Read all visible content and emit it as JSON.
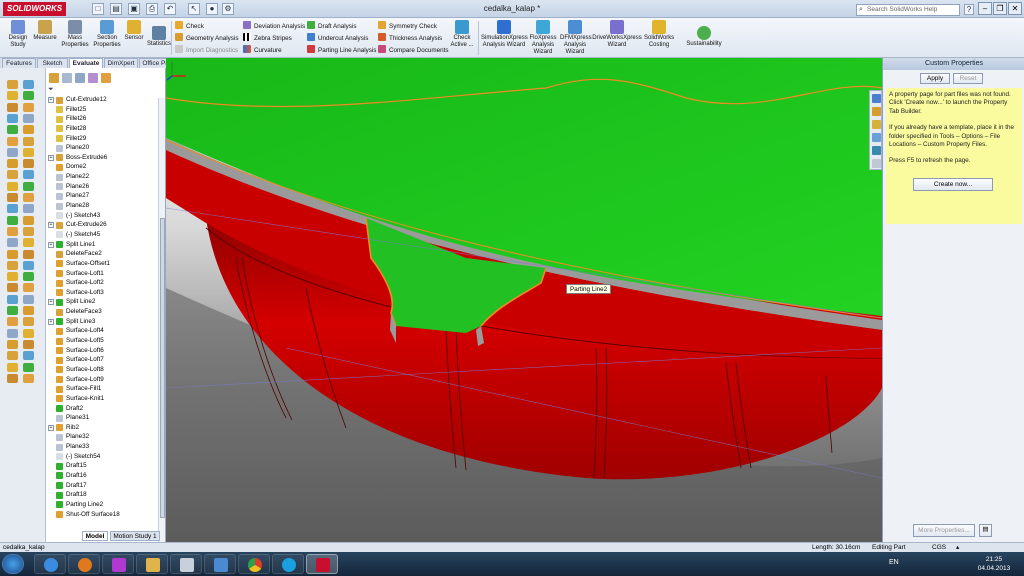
{
  "app": {
    "logo": "SOLIDWORKS",
    "document_title": "cedalka_kalap *",
    "help_search_placeholder": "Search SolidWorks Help"
  },
  "toolbar": {
    "design_study": "Design Study",
    "measure": "Measure",
    "mass_properties": "Mass Properties",
    "section_properties": "Section Properties",
    "sensor": "Sensor",
    "statistics": "Statistics",
    "check": "Check",
    "geometry_analysis": "Geometry Analysis",
    "import_diagnostics": "Import Diagnostics",
    "deviation_analysis": "Deviation Analysis",
    "zebra_stripes": "Zebra Stripes",
    "curvature": "Curvature",
    "draft_analysis": "Draft Analysis",
    "undercut_analysis": "Undercut Analysis",
    "parting_line_analysis": "Parting Line Analysis",
    "symmetry_check": "Symmetry Check",
    "thickness_analysis": "Thickness Analysis",
    "compare_documents": "Compare Documents",
    "check_active": "Check Active ...",
    "simulationxpress": "SimulationXpress Analysis Wizard",
    "floxpress": "FloXpress Analysis Wizard",
    "dfmxpress": "DFMXpress Analysis Wizard",
    "driveworksxpress": "DriveWorksXpress Wizard",
    "costing": "SolidWorks Costing",
    "sustainability": "Sustainability"
  },
  "tabs": [
    "Features",
    "Sketch",
    "Evaluate",
    "DimXpert",
    "Office Products"
  ],
  "active_tab": "Evaluate",
  "tree": {
    "filter_icon": "filter-icon",
    "items": [
      {
        "label": "Cut-Extrude12",
        "expandable": true
      },
      {
        "label": "Fillet25",
        "expandable": false
      },
      {
        "label": "Fillet26",
        "expandable": false
      },
      {
        "label": "Fillet28",
        "expandable": false
      },
      {
        "label": "Fillet29",
        "expandable": false
      },
      {
        "label": "Plane20",
        "expandable": false
      },
      {
        "label": "Boss-Extrude6",
        "expandable": true
      },
      {
        "label": "Dome2",
        "expandable": false
      },
      {
        "label": "Plane22",
        "expandable": false
      },
      {
        "label": "Plane26",
        "expandable": false
      },
      {
        "label": "Plane27",
        "expandable": false
      },
      {
        "label": "Plane28",
        "expandable": false
      },
      {
        "label": "(-) Sketch43",
        "expandable": false
      },
      {
        "label": "Cut-Extrude26",
        "expandable": true
      },
      {
        "label": "(-) Sketch45",
        "expandable": false
      },
      {
        "label": "Split Line1",
        "expandable": true
      },
      {
        "label": "DeleteFace2",
        "expandable": false
      },
      {
        "label": "Surface-Offset1",
        "expandable": false
      },
      {
        "label": "Surface-Loft1",
        "expandable": false
      },
      {
        "label": "Surface-Loft2",
        "expandable": false
      },
      {
        "label": "Surface-Loft3",
        "expandable": false
      },
      {
        "label": "Split Line2",
        "expandable": true
      },
      {
        "label": "DeleteFace3",
        "expandable": false
      },
      {
        "label": "Split Line3",
        "expandable": true
      },
      {
        "label": "Surface-Loft4",
        "expandable": false
      },
      {
        "label": "Surface-Loft5",
        "expandable": false
      },
      {
        "label": "Surface-Loft6",
        "expandable": false
      },
      {
        "label": "Surface-Loft7",
        "expandable": false
      },
      {
        "label": "Surface-Loft8",
        "expandable": false
      },
      {
        "label": "Surface-Loft9",
        "expandable": false
      },
      {
        "label": "Surface-Fill1",
        "expandable": false
      },
      {
        "label": "Surface-Knit1",
        "expandable": false
      },
      {
        "label": "Draft2",
        "expandable": false
      },
      {
        "label": "Plane31",
        "expandable": false
      },
      {
        "label": "Rib2",
        "expandable": true
      },
      {
        "label": "Plane32",
        "expandable": false
      },
      {
        "label": "Plane33",
        "expandable": false
      },
      {
        "label": "(-) Sketch54",
        "expandable": false
      },
      {
        "label": "Draft15",
        "expandable": false
      },
      {
        "label": "Draft16",
        "expandable": false
      },
      {
        "label": "Draft17",
        "expandable": false
      },
      {
        "label": "Draft18",
        "expandable": false
      },
      {
        "label": "Parting Line2",
        "expandable": false
      },
      {
        "label": "Shut-Off Surface18",
        "expandable": false
      }
    ],
    "bottom_tabs": [
      "Model",
      "Motion Study 1"
    ]
  },
  "viewport": {
    "tooltip": "Parting Line2",
    "colors": {
      "green": "#1ec91e",
      "red": "#d40000",
      "parting": "#f08a24",
      "floor": "#6e6e6e"
    }
  },
  "property_pane": {
    "title": "Custom Properties",
    "apply": "Apply",
    "reset": "Reset",
    "msg1": "A property page for part files was not found. Click 'Create now...' to launch the Property Tab Builder.",
    "msg2": "If you already have a template, place it in the folder specified in Tools – Options – File Locations – Custom Property Files.",
    "msg3": "Press F5 to refresh the page.",
    "create_now": "Create now...",
    "more_properties": "More Properties..."
  },
  "status": {
    "doc": "cedalka_kalap",
    "length": "Length: 30.16cm",
    "mode": "Editing Part",
    "units": "CGS"
  },
  "taskbar": {
    "lang": "EN",
    "time": "21:25",
    "date": "04.04.2013"
  }
}
